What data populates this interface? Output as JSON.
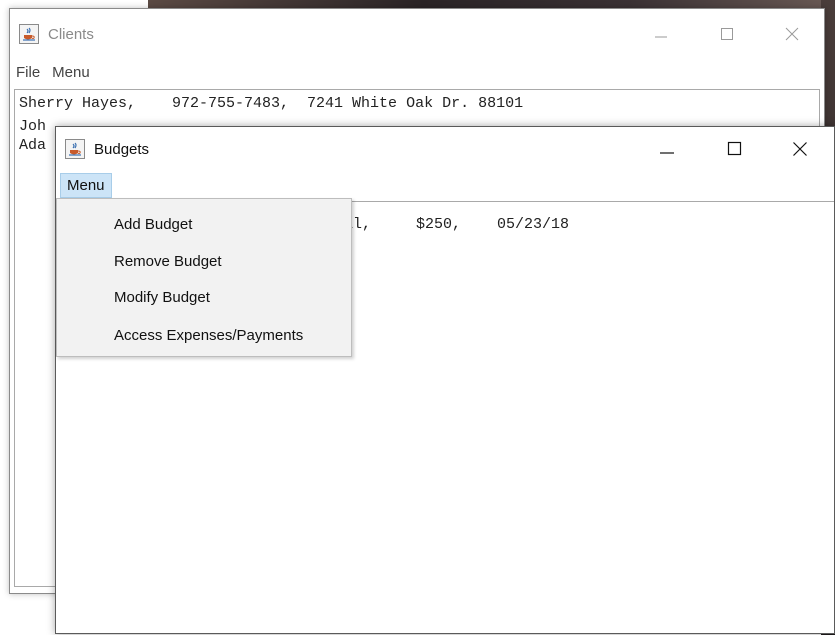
{
  "clients_window": {
    "title": "Clients",
    "menus": [
      "File",
      "Menu"
    ],
    "rows": [
      "Sherry Hayes,    972-755-7483,  7241 White Oak Dr. 88101",
      "Joh",
      "Ada"
    ]
  },
  "budgets_window": {
    "title": "Budgets",
    "menu_label": "Menu",
    "rows": [
      "oval,     $250,    05/23/18"
    ],
    "dropdown_items": [
      "Add Budget",
      "Remove Budget",
      "Modify Budget",
      "Access Expenses/Payments"
    ]
  },
  "icons": {
    "app": "java-cup-icon",
    "minimize": "minimize-icon",
    "maximize": "maximize-icon",
    "close": "close-icon"
  },
  "colors": {
    "menu_highlight": "#cce4f7",
    "dropdown_bg": "#f2f2f2",
    "inactive_title": "#8a8a8a"
  }
}
